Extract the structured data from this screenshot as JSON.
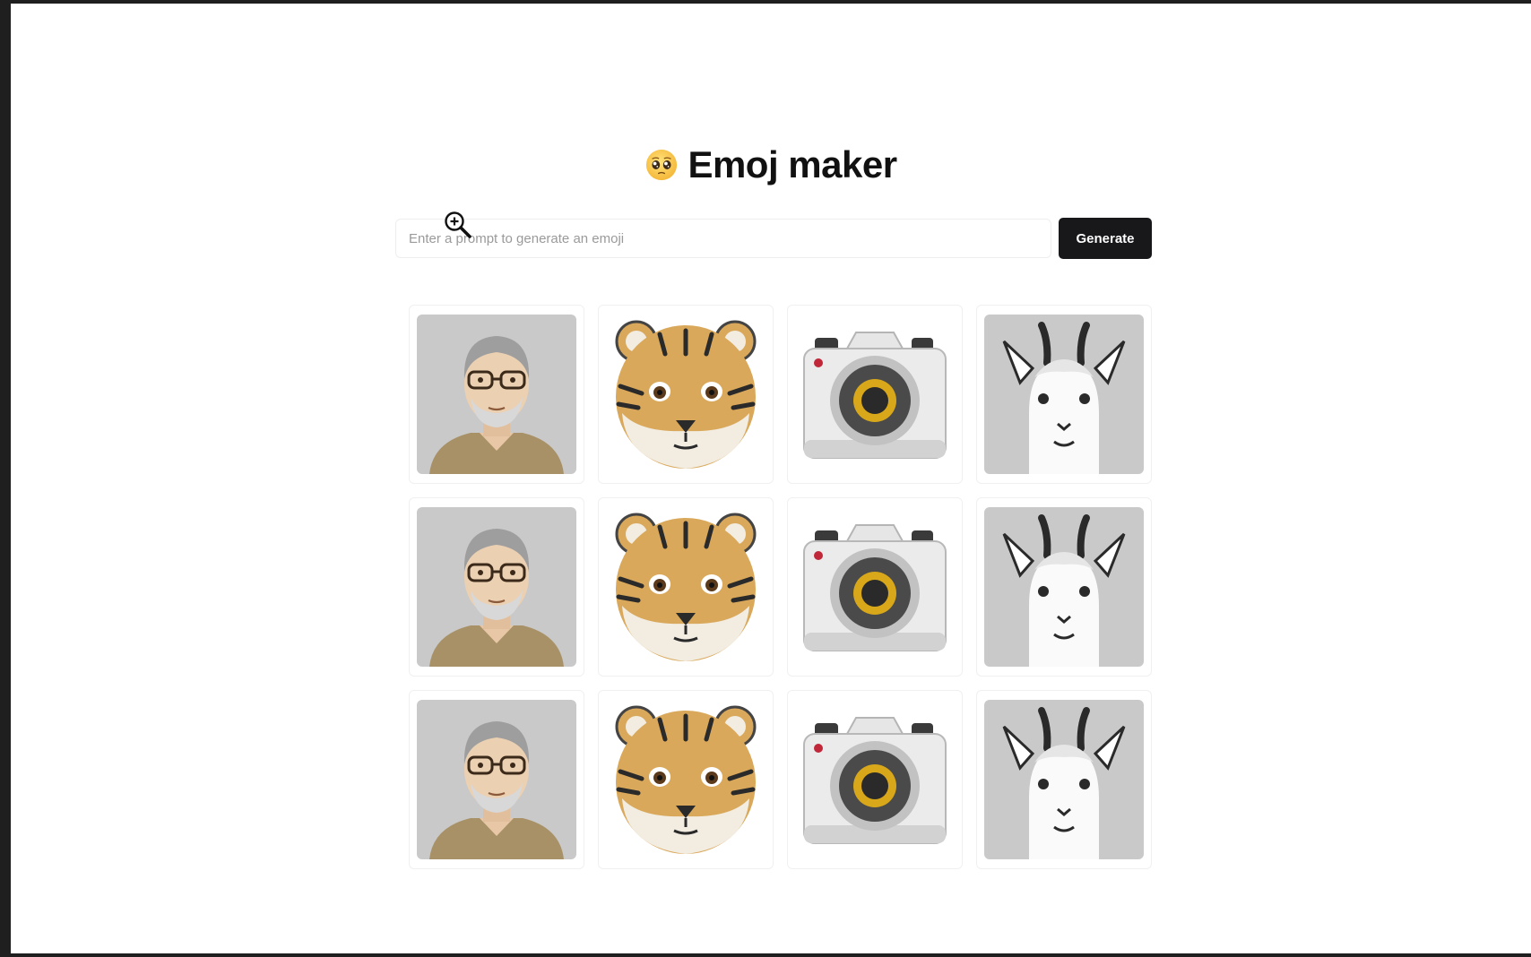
{
  "header": {
    "title": "Emoj maker",
    "title_icon": "pleading-face-icon"
  },
  "prompt": {
    "placeholder": "Enter a prompt to generate an emoji",
    "value": "",
    "button_label": "Generate"
  },
  "cursor": {
    "icon": "zoom-in-cursor-icon"
  },
  "grid": {
    "columns": [
      "man-with-glasses-emoji",
      "tiger-face-emoji",
      "camera-emoji",
      "llama-face-emoji"
    ],
    "rows": 3
  },
  "colors": {
    "button_bg": "#18181b",
    "button_text": "#ffffff",
    "title_text": "#111111",
    "tile_gray_bg": "#c9c9c9"
  }
}
